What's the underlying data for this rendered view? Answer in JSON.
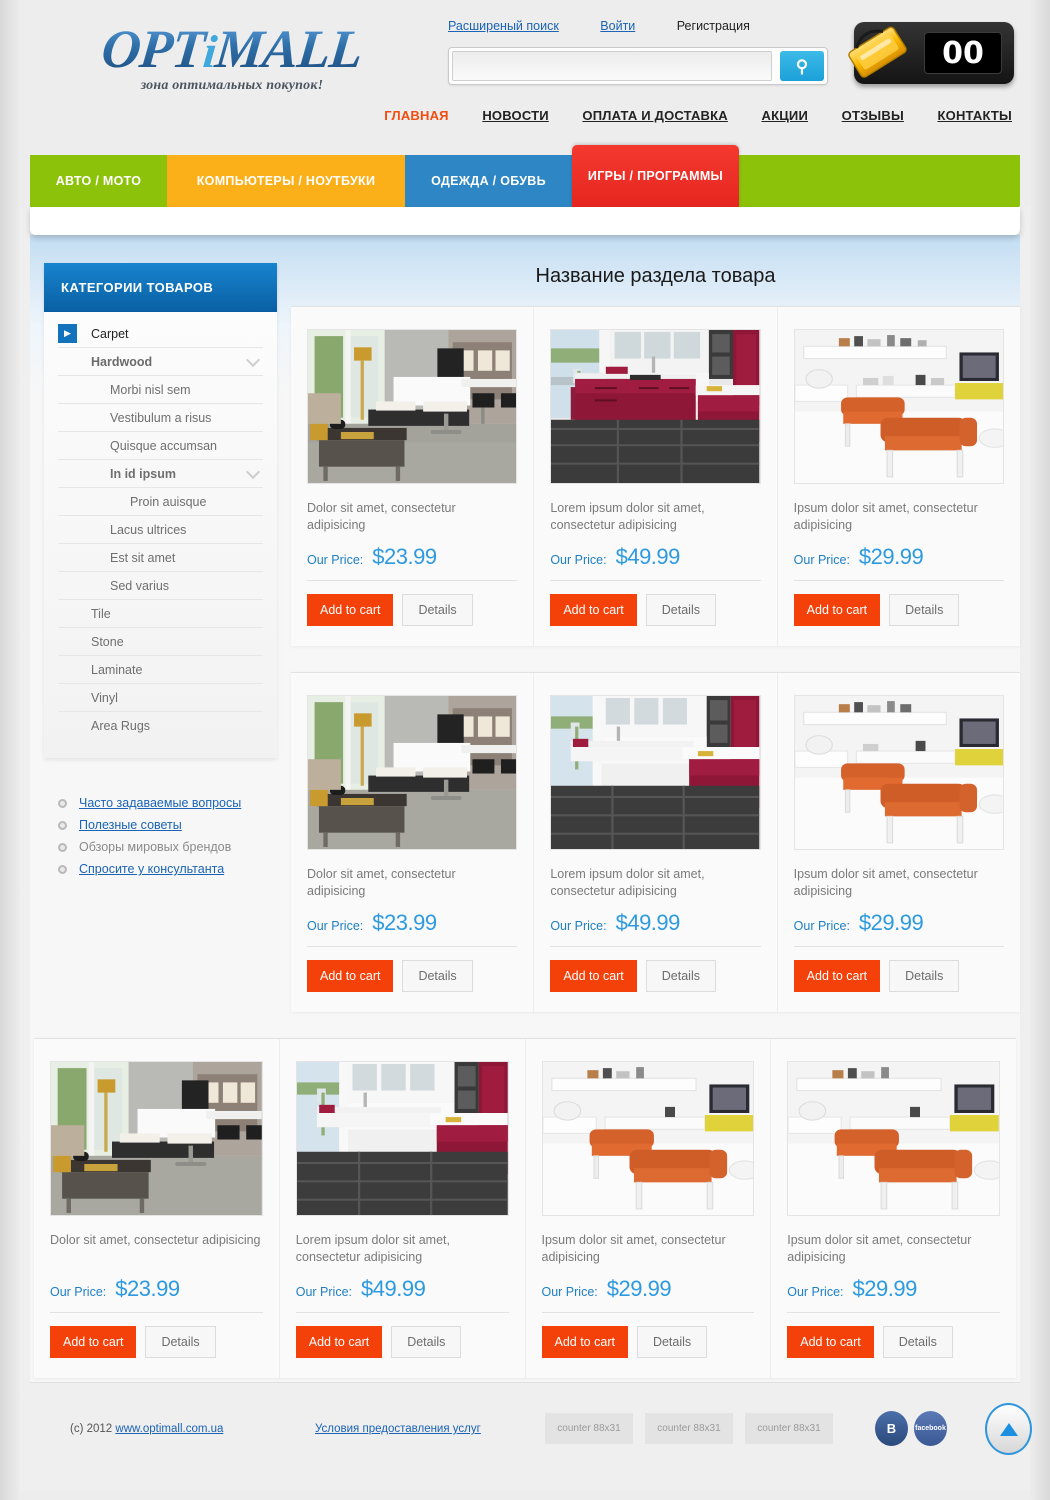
{
  "header": {
    "logo_text": "OPT",
    "logo_dot": "i",
    "logo_text2": "MALL",
    "tagline": "зона оптимальных покупок!",
    "toplinks": [
      {
        "label": "Расширеный поиск",
        "link": true
      },
      {
        "label": "Войти",
        "link": true
      },
      {
        "label": "Регистрация",
        "link": false
      }
    ],
    "search": {
      "value": "",
      "placeholder": "",
      "icon": "search-icon"
    },
    "cart": {
      "count": "00",
      "icon": "shopping-basket-icon"
    },
    "nav": [
      {
        "label": "ГЛАВНАЯ",
        "active": true
      },
      {
        "label": "НОВОСТИ",
        "active": false
      },
      {
        "label": "ОПЛАТА И ДОСТАВКА",
        "active": false
      },
      {
        "label": "АКЦИИ",
        "active": false
      },
      {
        "label": "ОТЗЫВЫ",
        "active": false
      },
      {
        "label": "КОНТАКТЫ",
        "active": false
      }
    ]
  },
  "category_tabs": [
    {
      "label": "АВТО / МОТО",
      "color": "#8cc20a"
    },
    {
      "label": "КОМПЬЮТЕРЫ / НОУТБУКИ",
      "color": "#fbaf18"
    },
    {
      "label": "ОДЕЖДА / ОБУВЬ",
      "color": "#2e87c4"
    },
    {
      "label": "ИГРЫ / ПРОГРАММЫ",
      "color": "#e52620"
    }
  ],
  "sidebar": {
    "title": "КАТЕГОРИИ ТОВАРОВ",
    "categories": [
      {
        "label": "Carpet",
        "level": 0,
        "arrow": true,
        "chevron": false
      },
      {
        "label": "Hardwood",
        "level": 1,
        "arrow": false,
        "chevron": true
      },
      {
        "label": "Morbi nisl sem",
        "level": 2,
        "arrow": false,
        "chevron": false
      },
      {
        "label": "Vestibulum a risus",
        "level": 2,
        "arrow": false,
        "chevron": false
      },
      {
        "label": "Quisque accumsan",
        "level": 2,
        "arrow": false,
        "chevron": false
      },
      {
        "label": "In id ipsum",
        "level": 2,
        "arrow": false,
        "chevron": true
      },
      {
        "label": "Proin auisque",
        "level": 3,
        "arrow": false,
        "chevron": false
      },
      {
        "label": "Lacus ultrices",
        "level": 2,
        "arrow": false,
        "chevron": false
      },
      {
        "label": "Est sit amet",
        "level": 2,
        "arrow": false,
        "chevron": false
      },
      {
        "label": "Sed varius",
        "level": 2,
        "arrow": false,
        "chevron": false
      },
      {
        "label": "Tile",
        "level": 1,
        "arrow": false,
        "chevron": false
      },
      {
        "label": "Stone",
        "level": 1,
        "arrow": false,
        "chevron": false
      },
      {
        "label": "Laminate",
        "level": 1,
        "arrow": false,
        "chevron": false
      },
      {
        "label": "Vinyl",
        "level": 1,
        "arrow": false,
        "chevron": false
      },
      {
        "label": "Area Rugs",
        "level": 1,
        "arrow": false,
        "chevron": false
      }
    ],
    "links": [
      {
        "label": "Часто задаваемые вопросы",
        "link": true
      },
      {
        "label": "Полезные советы",
        "link": true
      },
      {
        "label": "Обзоры мировых брендов",
        "link": false
      },
      {
        "label": "Спросите у консультанта",
        "link": true
      }
    ]
  },
  "main": {
    "section_title": "Название раздела товара",
    "price_label": "Our Price:",
    "add_to_cart_label": "Add to cart",
    "details_label": "Details",
    "rows": [
      {
        "cards": [
          {
            "title": "Dolor sit amet, consectetur adipisicing",
            "price": "$23.99",
            "image": "living-room-dark-table"
          },
          {
            "title": "Lorem ipsum dolor sit amet, consectetur adipisicing",
            "price": "$49.99",
            "image": "kitchen-purple-cabinets"
          },
          {
            "title": "Ipsum dolor sit amet, consectetur adipisicing",
            "price": "$29.99",
            "image": "white-room-orange-sofas"
          }
        ]
      },
      {
        "cards": [
          {
            "title": "Dolor sit amet, consectetur adipisicing",
            "price": "$23.99",
            "image": "living-room-dark-table"
          },
          {
            "title": "Lorem ipsum dolor sit amet, consectetur adipisicing",
            "price": "$49.99",
            "image": "kitchen-purple-cabinets"
          },
          {
            "title": "Ipsum dolor sit amet, consectetur adipisicing",
            "price": "$29.99",
            "image": "white-room-orange-sofas"
          }
        ]
      },
      {
        "cards": [
          {
            "title": "Dolor sit amet, consectetur adipisicing",
            "price": "$23.99",
            "image": "living-room-dark-table"
          },
          {
            "title": "Lorem ipsum dolor sit amet, consectetur adipisicing",
            "price": "$49.99",
            "image": "kitchen-purple-cabinets"
          },
          {
            "title": "Ipsum dolor sit amet, consectetur adipisicing",
            "price": "$29.99",
            "image": "white-room-orange-sofas"
          },
          {
            "title": "Ipsum dolor sit amet, consectetur adipisicing",
            "price": "$29.99",
            "image": "white-room-orange-sofas"
          }
        ]
      }
    ]
  },
  "footer": {
    "copyright": "(c) 2012 ",
    "site": "www.optimall.com.ua",
    "terms": "Условия предоставления услуг",
    "counters": [
      "counter 88x31",
      "counter 88x31",
      "counter 88x31"
    ],
    "social": [
      {
        "label": "В",
        "name": "vk-icon"
      },
      {
        "label": "facebook",
        "name": "facebook-icon"
      }
    ],
    "to_top": "▲"
  },
  "colors": {
    "accent_orange": "#f4410a",
    "accent_blue": "#2d9ae0",
    "nav_active": "#f04e11",
    "sidebar_head": "#0a5fa3"
  }
}
